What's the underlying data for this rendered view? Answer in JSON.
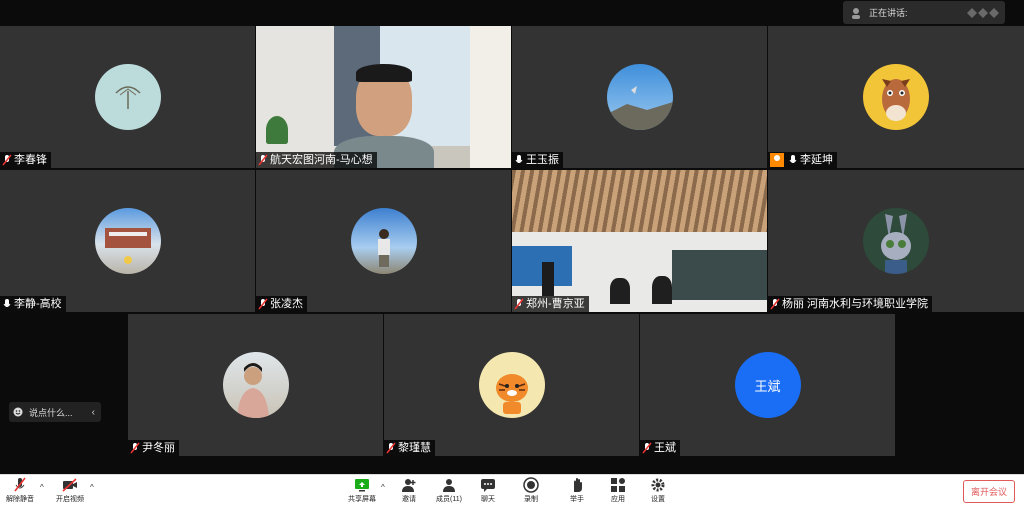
{
  "speaker_panel": {
    "label": "正在讲话:"
  },
  "participants": [
    {
      "name": "李春锋"
    },
    {
      "name": "航天宏图河南-马心想"
    },
    {
      "name": "王玉振"
    },
    {
      "name": "李延坤"
    },
    {
      "name": "李静-高校"
    },
    {
      "name": "张凌杰"
    },
    {
      "name": "郑州-曹京亚"
    },
    {
      "name": "杨丽 河南水利与环境职业学院"
    },
    {
      "name": "尹冬丽"
    },
    {
      "name": "黎瑾慧"
    },
    {
      "name": "王斌",
      "avatar_text": "王斌",
      "avatar_color": "#1a6ef5"
    }
  ],
  "chat": {
    "placeholder": "说点什么..."
  },
  "toolbar": {
    "unmute": "解除静音",
    "start_video": "开启视频",
    "share_screen": "共享屏幕",
    "invite": "邀请",
    "members": "成员(11)",
    "chat": "聊天",
    "record": "录制",
    "raise_hand": "举手",
    "apps": "应用",
    "settings": "设置",
    "leave": "离开会议"
  },
  "colors": {
    "tile_bg": "#333333",
    "leave": "#e05a5a",
    "host_badge": "#ff8a00",
    "share_green": "#1aad19"
  }
}
